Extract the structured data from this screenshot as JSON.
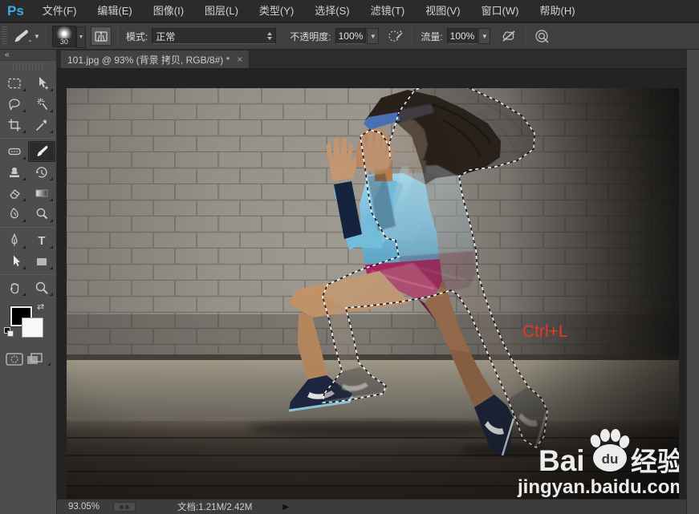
{
  "app": {
    "logo": "Ps"
  },
  "menu": {
    "items": [
      "文件(F)",
      "编辑(E)",
      "图像(I)",
      "图层(L)",
      "类型(Y)",
      "选择(S)",
      "滤镜(T)",
      "视图(V)",
      "窗口(W)",
      "帮助(H)"
    ]
  },
  "options_bar": {
    "tool_icon": "brush-icon",
    "brush_size": "30",
    "preset_icons": [
      "brush-preset-picker",
      "toggle-brush-panel-icon"
    ],
    "mode_label": "模式:",
    "mode_value": "正常",
    "opacity_label": "不透明度:",
    "opacity_value": "100%",
    "pressure_opacity_icon": "tablet-pressure-opacity-icon",
    "flow_label": "流量:",
    "flow_value": "100%",
    "airbrush_icon": "airbrush-icon",
    "pressure_size_icon": "tablet-pressure-size-icon",
    "dropdown_arrow": "▼"
  },
  "tab": {
    "title": "101.jpg @ 93% (背景 拷贝, RGB/8#) *",
    "close": "×"
  },
  "toolbar": {
    "collapse": "«",
    "tools": [
      "rectangular-marquee-tool",
      "move-tool",
      "lasso-tool",
      "magic-wand-tool",
      "crop-tool",
      "eyedropper-tool",
      "healing-brush-tool",
      "brush-tool",
      "clone-stamp-tool",
      "history-brush-tool",
      "eraser-tool",
      "gradient-tool",
      "smudge-tool",
      "dodge-tool",
      "pen-tool",
      "type-tool",
      "path-selection-tool",
      "shape-tool",
      "hand-tool",
      "zoom-tool"
    ],
    "selected_tool": "brush-tool",
    "foreground_color": "#000000",
    "background_color": "#f8f8f8",
    "extras": [
      "swap-colors-icon",
      "default-colors-icon",
      "quick-mask-icon",
      "screen-mode-icon"
    ]
  },
  "canvas": {
    "annotation": "Ctrl+L",
    "annotation_color": "#ee3428",
    "watermark": {
      "logo_bai": "Bai",
      "logo_du": "du",
      "logo_cn": "经验",
      "url": "jingyan.baidu.com",
      "paw_icon": "baidu-paw-icon"
    }
  },
  "status_bar": {
    "zoom": "93.05%",
    "doc_info": "文档:1.21M/2.42M",
    "expand": "▶",
    "sync_icon": "status-sync-icon"
  },
  "colors": {
    "ui_panel": "#4d4d4d",
    "canvas_bg": "#232323",
    "shirt_blue": "#8ed0ea",
    "shorts_magenta": "#b02a62",
    "logo_blue": "#3fa9e8"
  }
}
